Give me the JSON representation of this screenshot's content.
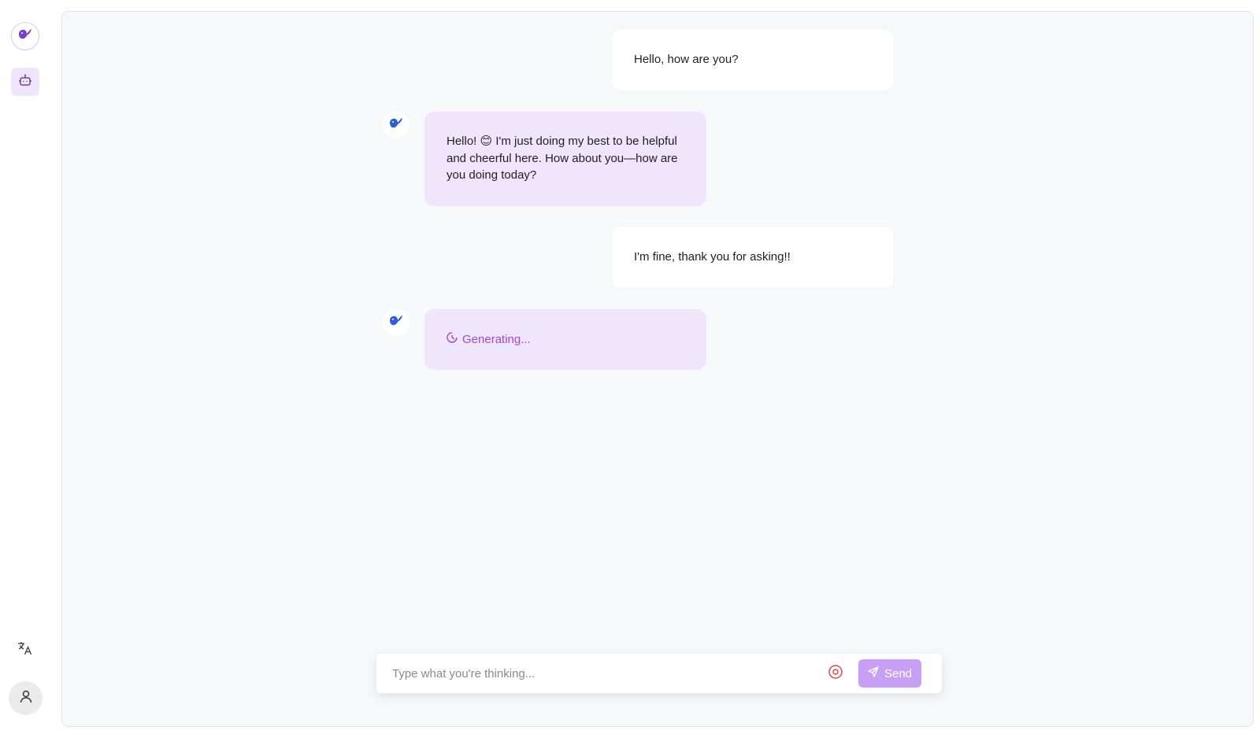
{
  "sidebar": {
    "logo_icon": "whale-logo-icon",
    "bot_icon": "robot-icon",
    "language_icon": "translate-icon",
    "user_icon": "user-icon"
  },
  "messages": [
    {
      "role": "user",
      "text": "Hello, how are you?"
    },
    {
      "role": "assistant",
      "text": "Hello! 😊 I'm just doing my best to be helpful and cheerful here. How about you—how are you doing today?"
    },
    {
      "role": "user",
      "text": "I'm fine, thank you for asking!!"
    },
    {
      "role": "assistant",
      "status": "Generating..."
    }
  ],
  "composer": {
    "placeholder": "Type what you're thinking...",
    "value": "",
    "send_label": "Send"
  },
  "colors": {
    "accent": "#c79ff4",
    "assistant_bubble": "#efe6fd",
    "generating_text": "#a347c7",
    "stop_icon": "#e0454f",
    "whale_logo": "#2f5fd8"
  }
}
